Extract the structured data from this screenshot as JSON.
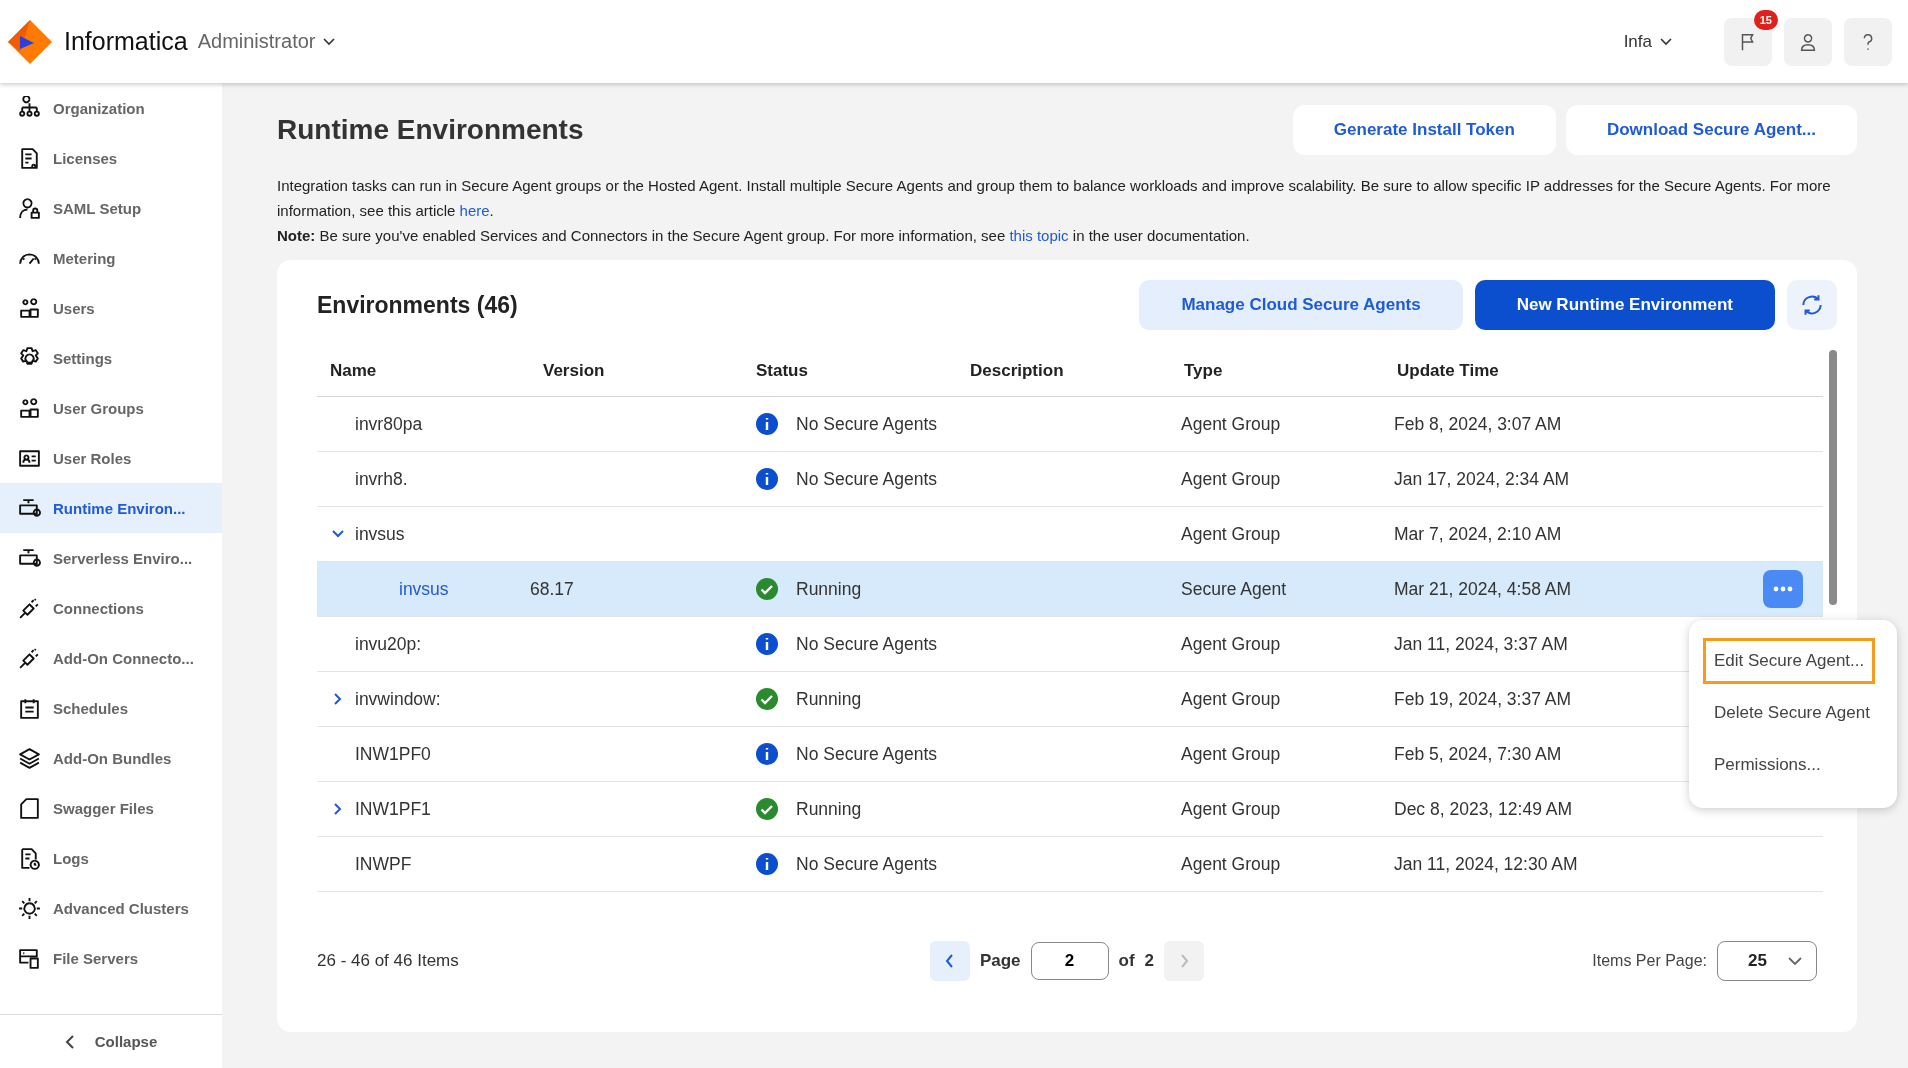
{
  "header": {
    "brand": "Informatica",
    "app": "Administrator",
    "user": "Infa",
    "notification_count": "15"
  },
  "sidebar": {
    "items": [
      {
        "label": "Organization",
        "selected": false
      },
      {
        "label": "Licenses",
        "selected": false
      },
      {
        "label": "SAML Setup",
        "selected": false
      },
      {
        "label": "Metering",
        "selected": false
      },
      {
        "label": "Users",
        "selected": false
      },
      {
        "label": "Settings",
        "selected": false
      },
      {
        "label": "User Groups",
        "selected": false
      },
      {
        "label": "User Roles",
        "selected": false
      },
      {
        "label": "Runtime Environ...",
        "selected": true
      },
      {
        "label": "Serverless Enviro...",
        "selected": false
      },
      {
        "label": "Connections",
        "selected": false
      },
      {
        "label": "Add-On Connecto...",
        "selected": false
      },
      {
        "label": "Schedules",
        "selected": false
      },
      {
        "label": "Add-On Bundles",
        "selected": false
      },
      {
        "label": "Swagger Files",
        "selected": false
      },
      {
        "label": "Logs",
        "selected": false
      },
      {
        "label": "Advanced Clusters",
        "selected": false
      },
      {
        "label": "File Servers",
        "selected": false
      }
    ],
    "collapse": "Collapse"
  },
  "page": {
    "title": "Runtime Environments",
    "buttons": [
      "Generate Install Token",
      "Download Secure Agent..."
    ],
    "intro": "Integration tasks can run in Secure Agent groups or the Hosted Agent. Install multiple Secure Agents and group them to balance workloads and improve scalability. Be sure to allow specific IP addresses for the Secure Agents. For more information, see this article",
    "intro_link": "here",
    "intro_end": ".",
    "note": "**Note:** Be sure you've enabled Services and Connectors in the Secure Agent group. For more information, see",
    "note_link": "this topic",
    "note_end": "in the user documentation."
  },
  "environments": {
    "title": "Environments (46)",
    "buttons": [
      "Manage Cloud Secure Agents",
      "New Runtime Environment"
    ],
    "columns": [
      "Name",
      "Version",
      "Status",
      "Description",
      "Type",
      "Update Time"
    ],
    "rows": [
      {
        "name": "invr80pa",
        "status": "No Secure Agents",
        "kind": "info",
        "type": "Agent Group",
        "time": "Feb 8, 2024, 3:07 AM",
        "selected": false
      },
      {
        "name": "invrh8.",
        "status": "No Secure Agents",
        "kind": "info",
        "type": "Agent Group",
        "time": "Jan 17, 2024, 2:34 AM",
        "selected": false
      },
      {
        "name": "invsus",
        "type": "Agent Group",
        "time": "Mar 7, 2024, 2:10 AM",
        "expanded": true,
        "selected": false,
        "children": [
          {
            "name": "invsus",
            "version": "68.17",
            "status": "Running",
            "kind": "ok",
            "type": "Secure Agent",
            "time": "Mar 21, 2024, 4:58 AM",
            "selected": true
          }
        ]
      },
      {
        "name": "invu20p:",
        "status": "No Secure Agents",
        "kind": "info",
        "type": "Agent Group",
        "time": "Jan 11, 2024, 3:37 AM",
        "selected": false
      },
      {
        "name": "invwindow:",
        "status": "Running",
        "kind": "ok",
        "type": "Agent Group",
        "time": "Feb 19, 2024, 3:37 AM",
        "expanded": false,
        "selected": false
      },
      {
        "name": "INW1PF0",
        "status": "No Secure Agents",
        "kind": "info",
        "type": "Agent Group",
        "time": "Feb 5, 2024, 7:30 AM",
        "selected": false
      },
      {
        "name": "INW1PF1",
        "status": "Running",
        "kind": "ok",
        "type": "Agent Group",
        "time": "Dec 8, 2023, 12:49 AM",
        "expanded": false,
        "selected": false
      },
      {
        "name": "INWPF",
        "status": "No Secure Agents",
        "kind": "info",
        "type": "Agent Group",
        "time": "Jan 11, 2024, 12:30 AM",
        "selected": false
      }
    ],
    "menu": [
      {
        "label": "Edit Secure Agent...",
        "selected": true
      },
      {
        "label": "Delete Secure Agent",
        "selected": false
      },
      {
        "label": "Permissions...",
        "selected": false
      }
    ],
    "pagination": {
      "range": "26 - 46 of 46 Items",
      "page_label": "Page",
      "page": "2",
      "of_label": "of",
      "total": "2",
      "per_page_label": "Items Per Page:",
      "per_page": "25"
    }
  }
}
